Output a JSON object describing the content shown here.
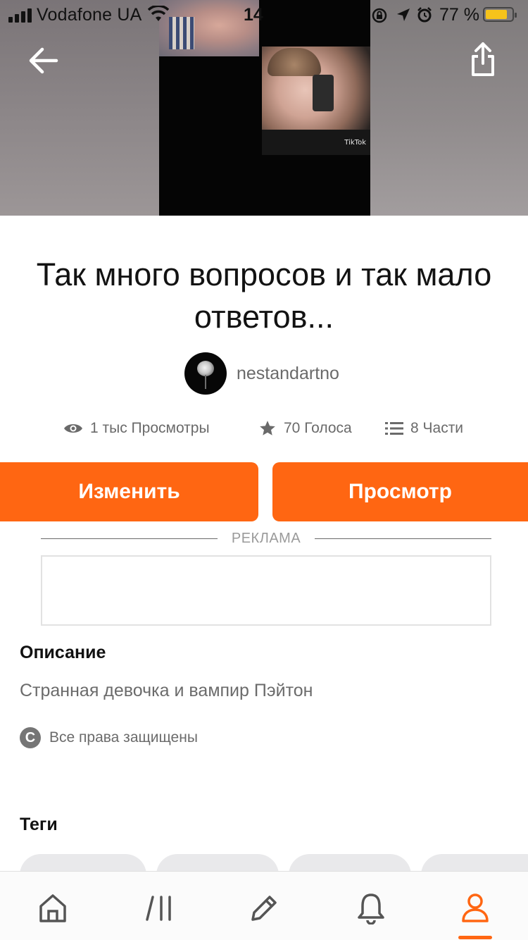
{
  "status_bar": {
    "carrier": "Vodafone UA",
    "time": "14",
    "battery": "77 %",
    "battery_level": 0.77
  },
  "icons": {
    "back": "arrow-left-icon",
    "share": "share-icon",
    "views": "eye-icon",
    "votes": "star-icon",
    "parts": "list-icon",
    "copyright": "copyright-icon"
  },
  "story": {
    "title": "Так много вопросов и так мало ответов...",
    "author": "nestandartno",
    "cover_watermark": "TikTok",
    "stats": {
      "views": "1 тыс Просмотры",
      "votes": "70 Голоса",
      "parts": "8 Части"
    }
  },
  "actions": {
    "edit_label": "Изменить",
    "view_label": "Просмотр"
  },
  "ad": {
    "label": "РЕКЛАМА"
  },
  "description": {
    "heading": "Описание",
    "text": "Странная девочка и вампир Пэйтон",
    "copyright": "Все права защищены"
  },
  "tags": {
    "heading": "Теги"
  },
  "bottom_nav": {
    "items": [
      "home-icon",
      "library-icon",
      "write-icon",
      "notifications-icon",
      "profile-icon"
    ],
    "active": "profile-icon"
  },
  "colors": {
    "accent": "#ff6612",
    "text_primary": "#121212",
    "text_secondary": "#6b6b6b",
    "battery": "#f6c31b"
  }
}
